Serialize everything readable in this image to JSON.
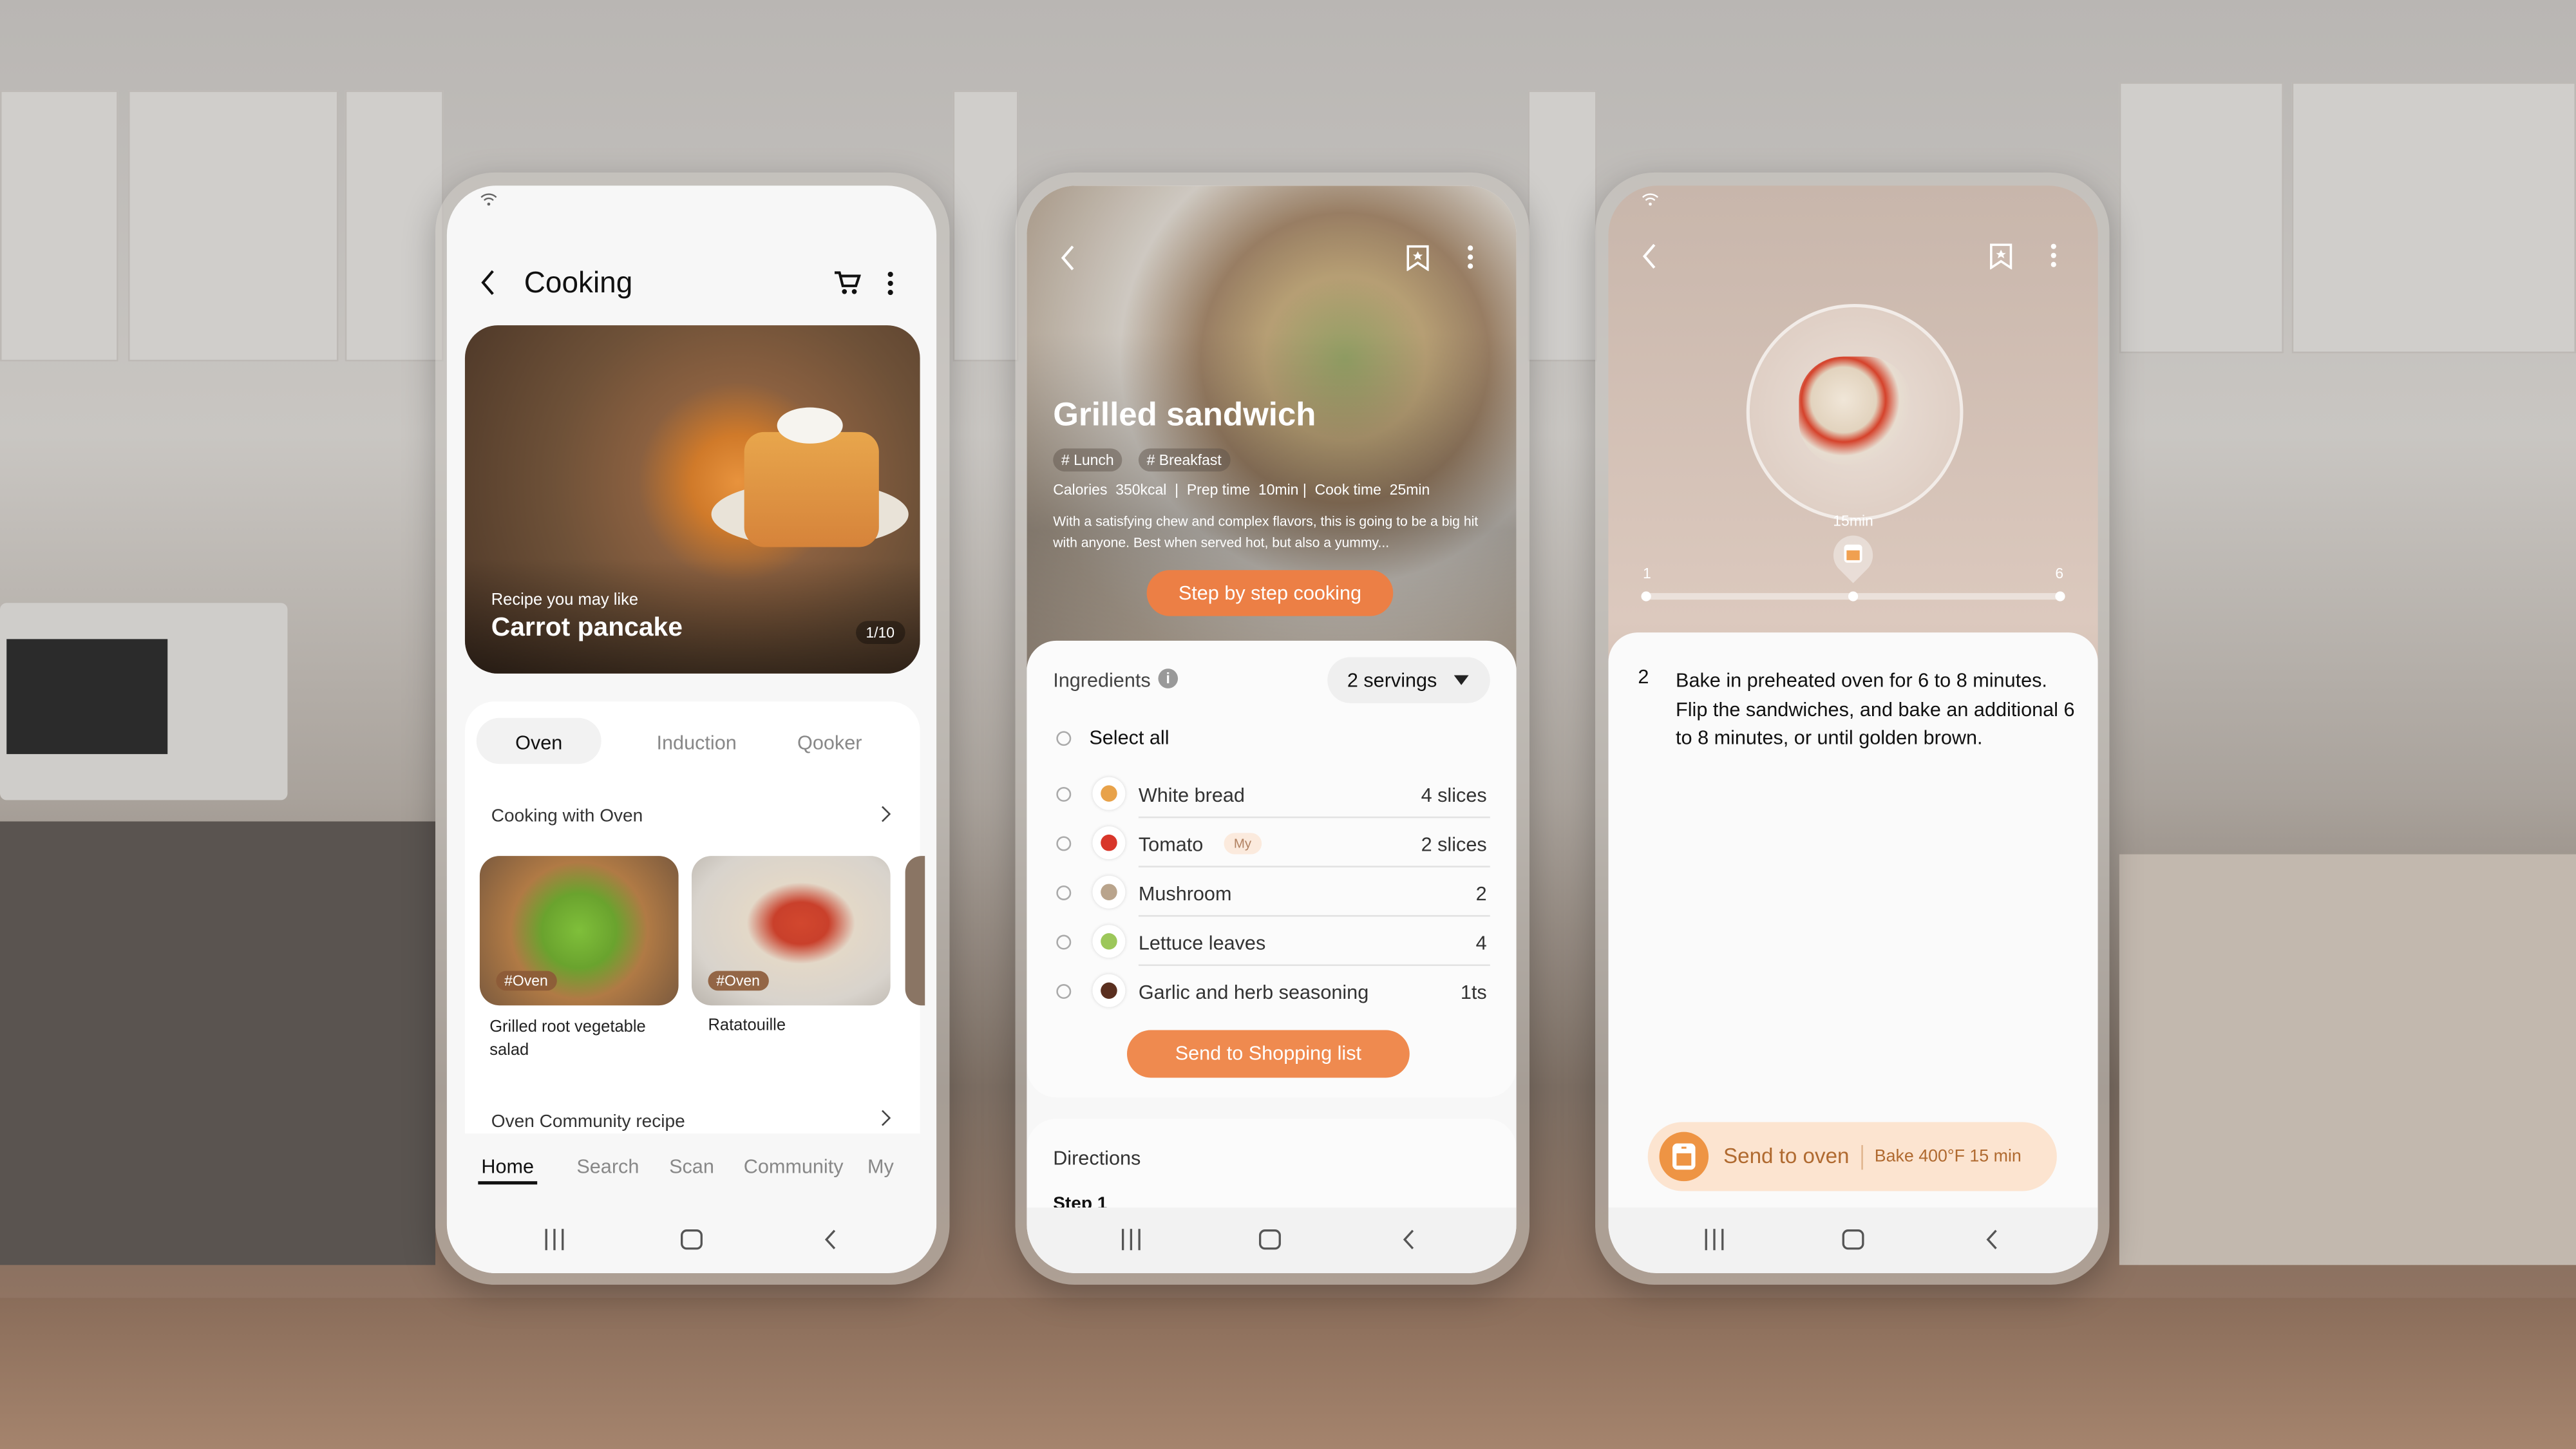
{
  "colors": {
    "accent": "#ef8a4f",
    "oven_orange": "#ee9444",
    "oven_chip_bg": "#fce4d0",
    "oven_text": "#b06a30"
  },
  "phone1": {
    "header": {
      "title": "Cooking",
      "back_icon": "chevron-left",
      "cart_icon": "shopping-cart",
      "more_icon": "more-vertical"
    },
    "hero": {
      "subtitle": "Recipe you may like",
      "title": "Carrot pancake",
      "counter": "1/10"
    },
    "appliance_tabs": [
      {
        "label": "Oven",
        "selected": true
      },
      {
        "label": "Induction",
        "selected": false
      },
      {
        "label": "Qooker",
        "selected": false
      }
    ],
    "section1": {
      "title": "Cooking with Oven"
    },
    "recipes": [
      {
        "tag": "#Oven",
        "title": "Grilled root vegetable salad"
      },
      {
        "tag": "#Oven",
        "title": "Ratatouille"
      }
    ],
    "section2": {
      "title": "Oven Community recipe"
    },
    "bottom_tabs": [
      {
        "label": "Home",
        "selected": true
      },
      {
        "label": "Search"
      },
      {
        "label": "Scan"
      },
      {
        "label": "Community"
      },
      {
        "label": "My"
      }
    ]
  },
  "phone2": {
    "title": "Grilled sandwich",
    "tags": [
      "# Lunch",
      "# Breakfast"
    ],
    "stats": {
      "calories_label": "Calories",
      "calories": "350kcal",
      "prep_label": "Prep time",
      "prep": "10min",
      "cook_label": "Cook time",
      "cook": "25min"
    },
    "description": "With a satisfying chew and complex flavors, this is going to be a big hit with anyone. Best when served hot, but also a yummy...",
    "cta": "Step by step cooking",
    "ingredients_title": "Ingredients",
    "servings": "2 servings",
    "select_all": "Select all",
    "ingredients": [
      {
        "name": "White bread",
        "qty": "4 slices",
        "icon": "sandwich"
      },
      {
        "name": "Tomato",
        "qty": "2 slices",
        "badge": "My",
        "icon": "tomato"
      },
      {
        "name": "Mushroom",
        "qty": "2",
        "icon": "mushroom"
      },
      {
        "name": "Lettuce leaves",
        "qty": "4",
        "icon": "lettuce"
      },
      {
        "name": "Garlic and herb seasoning",
        "qty": "1ts",
        "icon": "seasoning-bottles"
      }
    ],
    "shopping_button": "Send to Shopping list",
    "directions_title": "Directions",
    "step_label": "Step 1"
  },
  "phone3": {
    "timer_label": "15min",
    "slider": {
      "min_label": "1",
      "max_label": "6",
      "current_step": 2,
      "total_steps": 6
    },
    "step_number": "2",
    "step_text": "Bake in preheated oven for 6 to 8 minutes. Flip the sandwiches, and bake an additional 6 to 8 minutes, or until golden brown.",
    "send_button": "Send to oven",
    "send_detail": "Bake 400°F 15 min"
  }
}
